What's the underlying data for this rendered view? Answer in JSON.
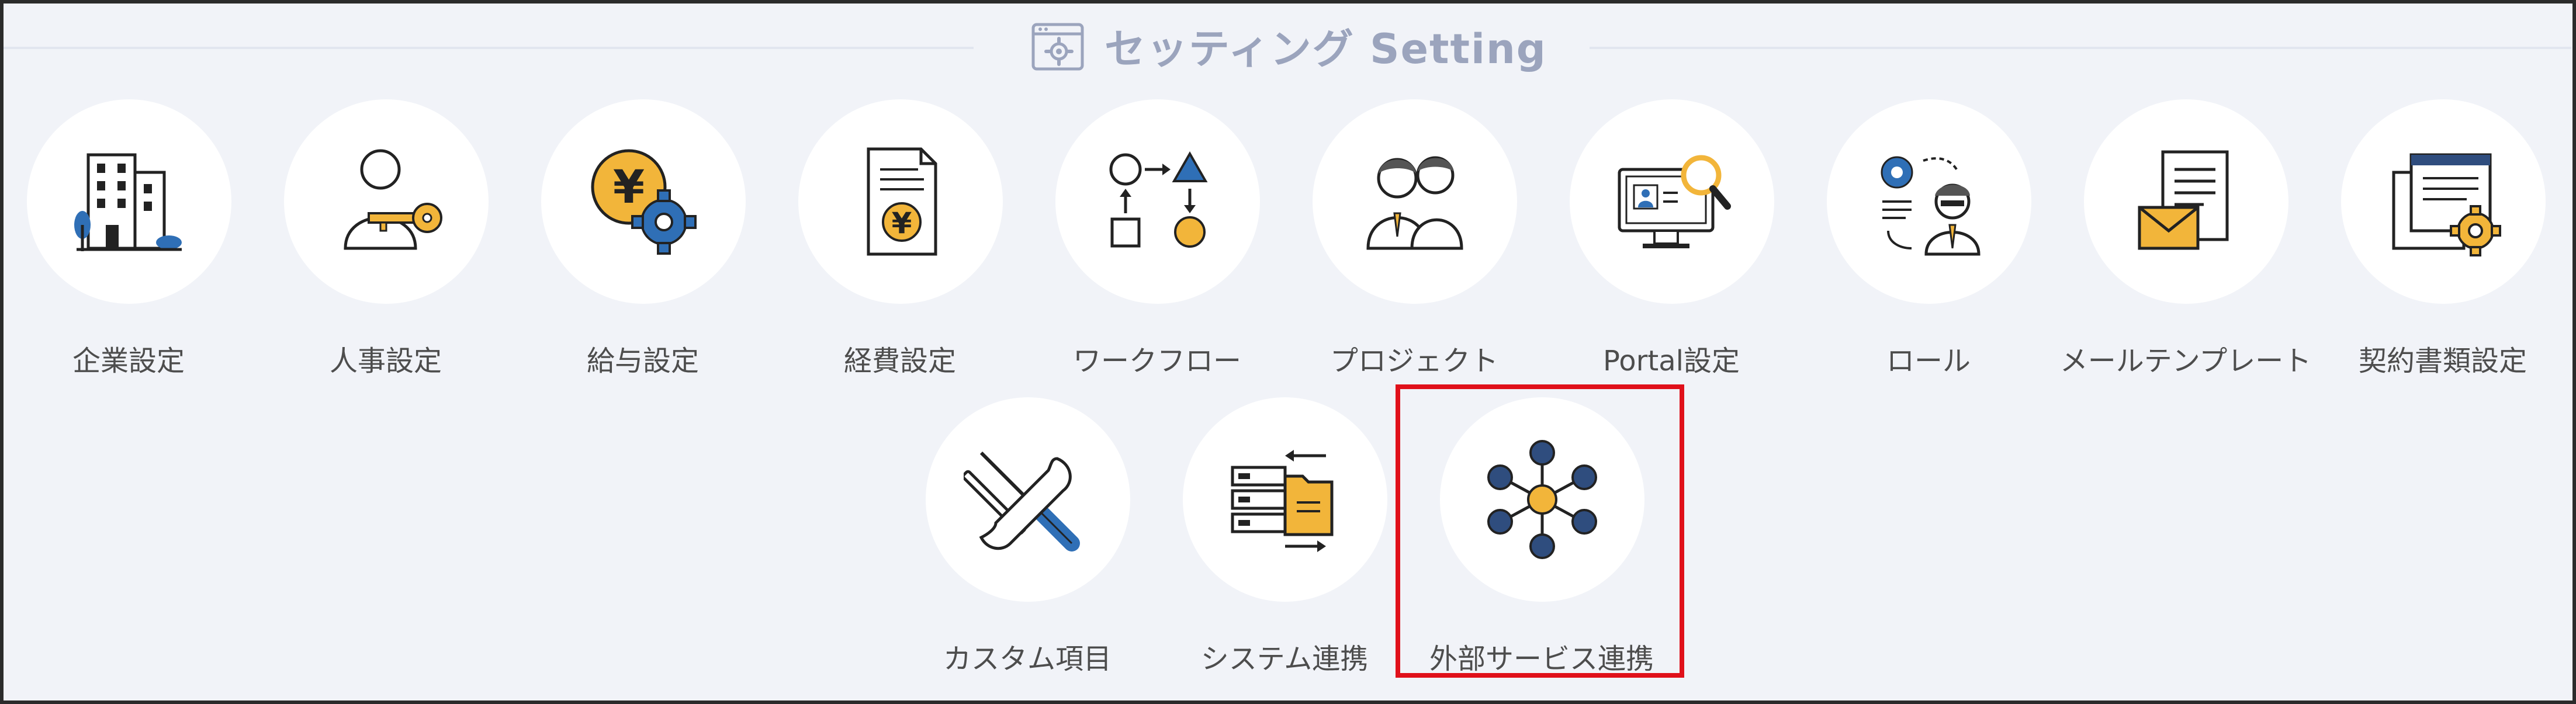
{
  "header": {
    "title": "セッティング Setting",
    "icon": "settings-window-icon"
  },
  "row1": [
    {
      "label": "企業設定",
      "icon": "company-building-icon"
    },
    {
      "label": "人事設定",
      "icon": "person-key-icon"
    },
    {
      "label": "給与設定",
      "icon": "yen-gear-icon"
    },
    {
      "label": "経費設定",
      "icon": "expense-document-icon"
    },
    {
      "label": "ワークフロー",
      "icon": "workflow-shapes-icon"
    },
    {
      "label": "プロジェクト",
      "icon": "project-people-icon"
    },
    {
      "label": "Portal設定",
      "icon": "portal-monitor-search-icon"
    },
    {
      "label": "ロール",
      "icon": "role-person-gear-icon"
    },
    {
      "label": "メールテンプレート",
      "icon": "mail-template-icon"
    },
    {
      "label": "契約書類設定",
      "icon": "contract-docs-gear-icon"
    }
  ],
  "row2": [
    {
      "label": "カスタム項目",
      "icon": "wrench-screwdriver-icon"
    },
    {
      "label": "システム連携",
      "icon": "server-folder-sync-icon"
    },
    {
      "label": "外部サービス連携",
      "icon": "network-hub-icon",
      "highlighted": true
    }
  ],
  "colors": {
    "background": "#f1f3f8",
    "title": "#9ba4bd",
    "navy": "#2f4d7e",
    "blue": "#2f6fb6",
    "gold": "#f2b53a",
    "highlight": "#e0101a"
  }
}
